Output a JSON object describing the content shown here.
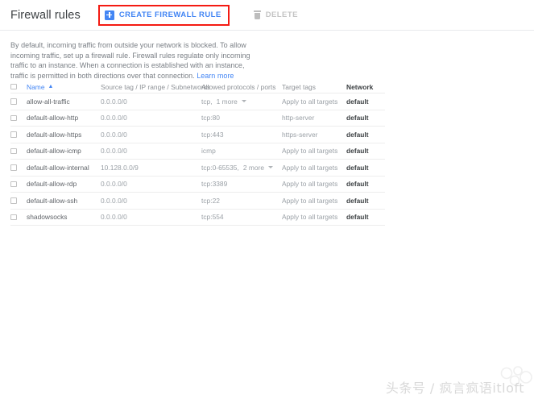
{
  "toolbar": {
    "title": "Firewall rules",
    "create_label": "CREATE FIREWALL RULE",
    "create_icon": "plus-icon",
    "delete_label": "DELETE",
    "delete_icon": "trash-icon",
    "highlight_color": "#f41a12",
    "accent_color": "#4285f4"
  },
  "description": {
    "text": "By default, incoming traffic from outside your network is blocked. To allow incoming traffic, set up a firewall rule. Firewall rules regulate only incoming traffic to an instance. When a connection is established with an instance, traffic is permitted in both directions over that connection. ",
    "link_label": "Learn more"
  },
  "table": {
    "columns": [
      {
        "key": "name",
        "label": "Name",
        "sorted": "asc",
        "sort_icon": "caret-up-icon"
      },
      {
        "key": "source",
        "label": "Source tag / IP range / Subnetworks"
      },
      {
        "key": "protocols",
        "label": "Allowed protocols / ports"
      },
      {
        "key": "target",
        "label": "Target tags"
      },
      {
        "key": "network",
        "label": "Network"
      }
    ],
    "rows": [
      {
        "name": "allow-all-traffic",
        "source": "0.0.0.0/0",
        "protocols": "tcp,",
        "more": "1 more",
        "has_caret": true,
        "target": "Apply to all targets",
        "network": "default"
      },
      {
        "name": "default-allow-http",
        "source": "0.0.0.0/0",
        "protocols": "tcp:80",
        "more": "",
        "has_caret": false,
        "target": "http-server",
        "network": "default"
      },
      {
        "name": "default-allow-https",
        "source": "0.0.0.0/0",
        "protocols": "tcp:443",
        "more": "",
        "has_caret": false,
        "target": "https-server",
        "network": "default"
      },
      {
        "name": "default-allow-icmp",
        "source": "0.0.0.0/0",
        "protocols": "icmp",
        "more": "",
        "has_caret": false,
        "target": "Apply to all targets",
        "network": "default"
      },
      {
        "name": "default-allow-internal",
        "source": "10.128.0.0/9",
        "protocols": "tcp:0-65535,",
        "more": "2 more",
        "has_caret": true,
        "target": "Apply to all targets",
        "network": "default"
      },
      {
        "name": "default-allow-rdp",
        "source": "0.0.0.0/0",
        "protocols": "tcp:3389",
        "more": "",
        "has_caret": false,
        "target": "Apply to all targets",
        "network": "default"
      },
      {
        "name": "default-allow-ssh",
        "source": "0.0.0.0/0",
        "protocols": "tcp:22",
        "more": "",
        "has_caret": false,
        "target": "Apply to all targets",
        "network": "default"
      },
      {
        "name": "shadowsocks",
        "source": "0.0.0.0/0",
        "protocols": "tcp:554",
        "more": "",
        "has_caret": false,
        "target": "Apply to all targets",
        "network": "default"
      }
    ]
  },
  "watermark": {
    "text": "头条号 / 疯言疯语itloft"
  }
}
